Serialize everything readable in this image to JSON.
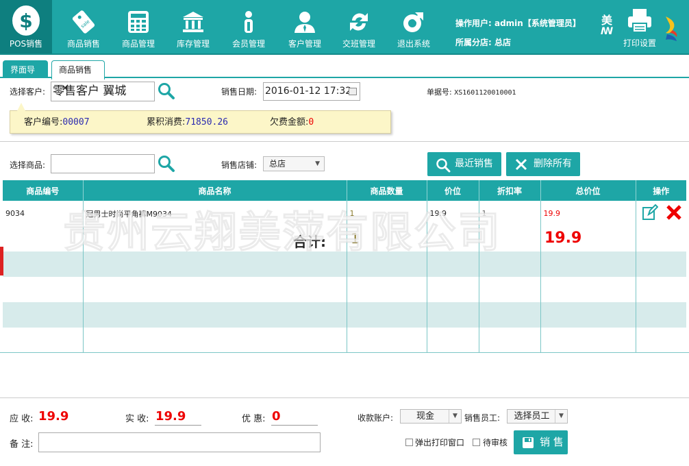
{
  "nav": {
    "items": [
      {
        "label": "POS销售",
        "icon": "dollar-icon"
      },
      {
        "label": "商品销售",
        "icon": "tag-icon"
      },
      {
        "label": "商品管理",
        "icon": "calculator-icon"
      },
      {
        "label": "库存管理",
        "icon": "bank-icon"
      },
      {
        "label": "会员管理",
        "icon": "info-icon"
      },
      {
        "label": "客户管理",
        "icon": "user-icon"
      },
      {
        "label": "交班管理",
        "icon": "refresh-icon"
      },
      {
        "label": "退出系统",
        "icon": "exit-icon"
      }
    ],
    "operator_label": "操作用户: admin【系统管理员】",
    "branch_label": "所属分店: 总店",
    "logo_text": "美",
    "print_label": "打印设置"
  },
  "tabs": [
    {
      "label": "界面导航"
    },
    {
      "label": "商品销售",
      "close": "×"
    }
  ],
  "customer": {
    "label": "选择客户:",
    "value": "零售客户 翼城",
    "date_label": "销售日期:",
    "date_value": "2016-01-12 17:32",
    "order_label": "单据号:",
    "order_value": "XS1601120010001",
    "info": {
      "code_label": "客户编号:",
      "code_value": "00007",
      "total_label": "累积消费:",
      "total_value": "71850.26",
      "debt_label": "欠费金额:",
      "debt_value": "0"
    }
  },
  "product": {
    "label": "选择商品:",
    "value": "",
    "store_label": "销售店铺:",
    "store_value": "总店",
    "recent_button": "最近销售",
    "delete_all_button": "删除所有"
  },
  "table": {
    "headers": [
      "商品编号",
      "商品名称",
      "商品数量",
      "价位",
      "折扣率",
      "总价位",
      "操作"
    ],
    "rows": [
      {
        "code": "9034",
        "name": "冠男士时尚平角裤M9034",
        "qty": "1",
        "price": "19.9",
        "discount": "1",
        "total": "19.9"
      }
    ],
    "total_label": "合计:",
    "total_qty": "1",
    "total_amount": "19.9"
  },
  "watermark": "贵州云翔美萍有限公司",
  "footer": {
    "due_label": "应 收:",
    "due_value": "19.9",
    "paid_label": "实 收:",
    "paid_value": "19.9",
    "discount_label": "优 惠:",
    "discount_value": "0",
    "account_label": "收款账户:",
    "account_value": "现金",
    "staff_label": "销售员工:",
    "staff_value": "选择员工",
    "remark_label": "备 注:",
    "print_popup_label": "弹出打印窗口",
    "pending_label": "待审核",
    "sell_button": "销 售"
  },
  "colors": {
    "accent": "#1ea6a6",
    "accent_dark": "#0e7f7f",
    "red": "#e00000"
  }
}
